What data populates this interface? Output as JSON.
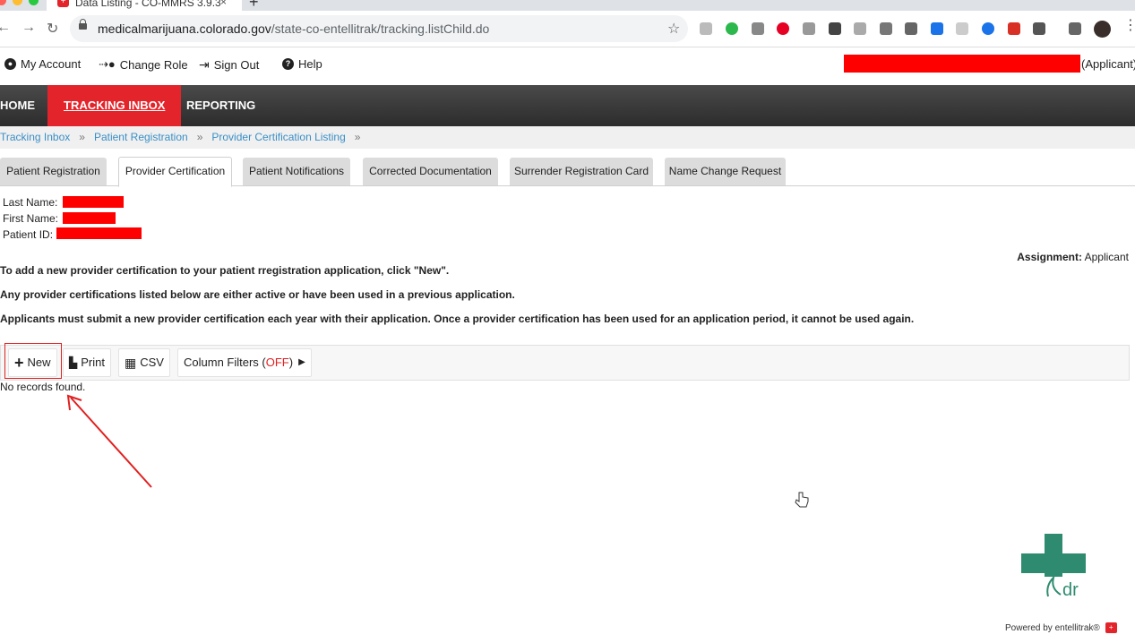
{
  "browser": {
    "tab_title": "Data Listing - CO-MMRS 3.9.3",
    "url_host": "medicalmarijuana.colorado.gov",
    "url_path": "/state-co-entellitrak/tracking.listChild.do"
  },
  "util": {
    "my_account": "My Account",
    "change_role": "Change Role",
    "sign_out": "Sign Out",
    "help": "Help",
    "applicant_role": "(Applicant)"
  },
  "nav": {
    "home": "HOME",
    "tracking_inbox": "TRACKING INBOX",
    "reporting": "REPORTING"
  },
  "breadcrumb": [
    "Tracking Inbox",
    "Patient Registration",
    "Provider Certification Listing"
  ],
  "breadcrumb_sep": "»",
  "tabs": [
    "Patient Registration",
    "Provider Certification",
    "Patient Notifications",
    "Corrected Documentation",
    "Surrender Registration Card",
    "Name Change Request"
  ],
  "patient": {
    "last_name_label": "Last Name:",
    "first_name_label": "First Name:",
    "patient_id_label": "Patient ID:"
  },
  "assignment": {
    "label": "Assignment:",
    "value": "Applicant"
  },
  "instructions": [
    "To add a new provider certification to your patient rregistration application, click \"New\".",
    "Any provider certifications listed below are either active or have been used in a previous application.",
    "Applicants must submit a new provider certification each year with their application. Once a provider certification has been used for an application period, it cannot be used again."
  ],
  "grid_toolbar": {
    "new": "New",
    "print": "Print",
    "csv": "CSV",
    "column_filters": "Column Filters (",
    "filters_state": "OFF",
    "filters_close": ")"
  },
  "empty_message": "No records found.",
  "footer": {
    "powered_by": "Powered by entellitrak®",
    "logo_text": "dr"
  },
  "colors": {
    "brand_red": "#e4242b",
    "link_blue": "#3a8fc6",
    "logo_green": "#2e8b6f"
  }
}
